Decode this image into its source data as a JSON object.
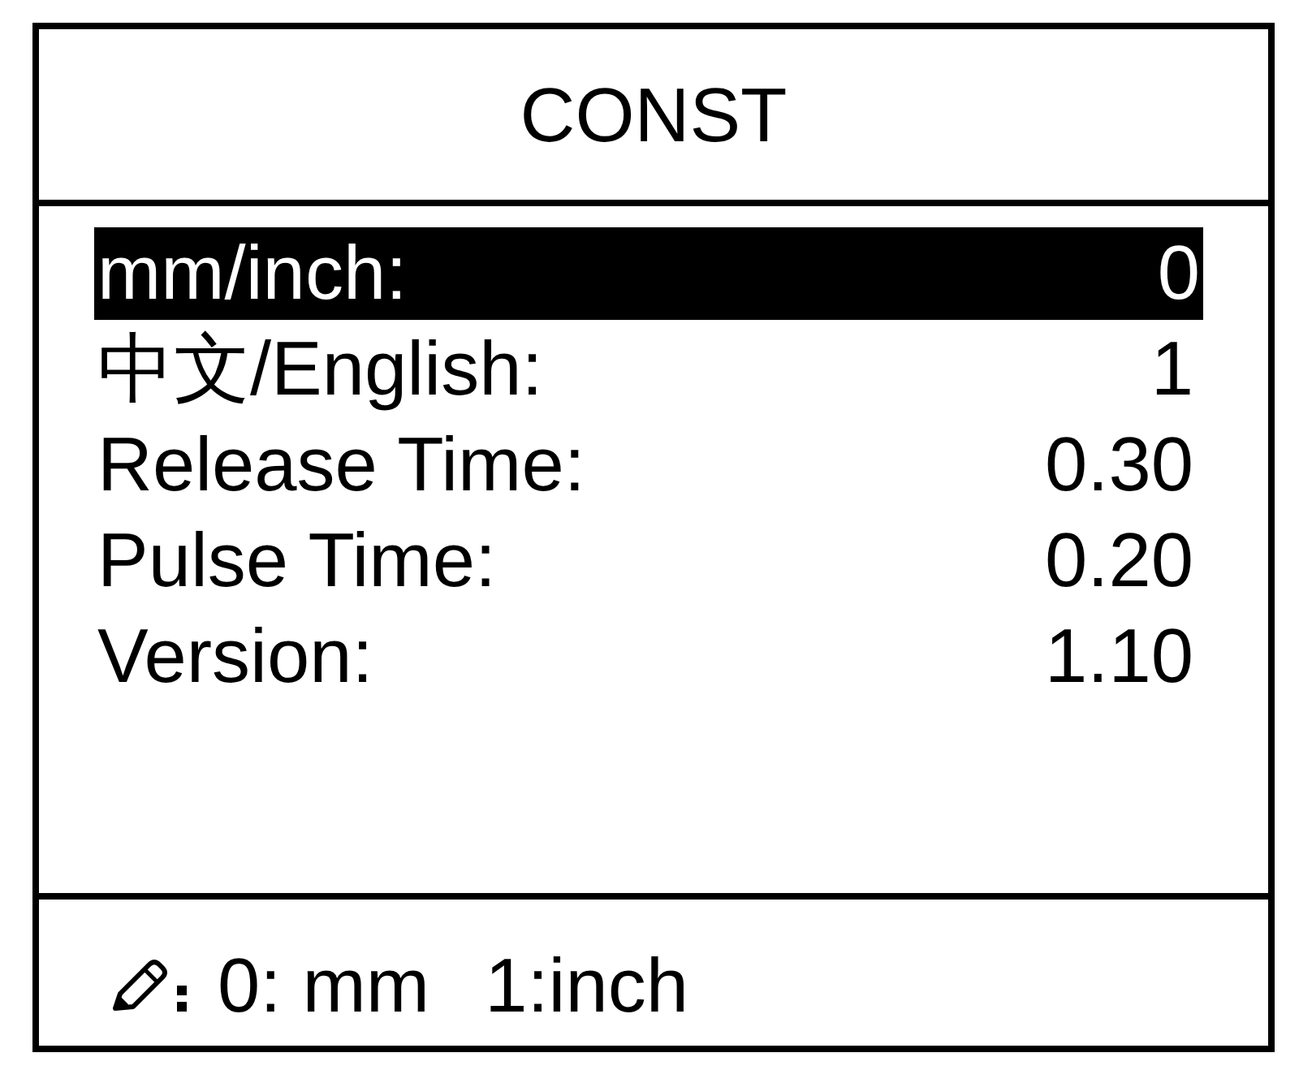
{
  "title": "CONST",
  "rows": [
    {
      "label": "mm/inch:",
      "value": "0",
      "selected": true
    },
    {
      "label": "中文/English:",
      "value": "1",
      "selected": false
    },
    {
      "label": "Release Time:",
      "value": "0.30",
      "selected": false
    },
    {
      "label": "Pulse Time:",
      "value": "0.20",
      "selected": false
    },
    {
      "label": "Version:",
      "value": "1.10",
      "selected": false
    }
  ],
  "footer": {
    "options": [
      "0: mm",
      "1:inch"
    ]
  }
}
